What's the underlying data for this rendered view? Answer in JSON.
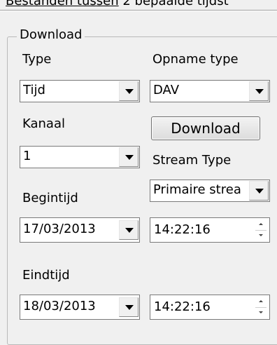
{
  "top": {
    "text_underlined": "Bestanden tussen",
    "text_rest": " 2 bepaalde tijdst"
  },
  "download_group": {
    "legend": "Download",
    "type_label": "Type",
    "type_value": "Tijd",
    "recording_type_label": "Opname type",
    "recording_type_value": "DAV",
    "channel_label": "Kanaal",
    "download_button": "Download",
    "channel_value": "1",
    "stream_type_label": "Stream Type",
    "stream_type_value": "Primaire strea",
    "start_time_label": "Begintijd",
    "start_date": "17/03/2013",
    "start_time": "14:22:16",
    "end_time_label": "Eindtijd",
    "end_date": "18/03/2013",
    "end_time": "14:22:16"
  }
}
